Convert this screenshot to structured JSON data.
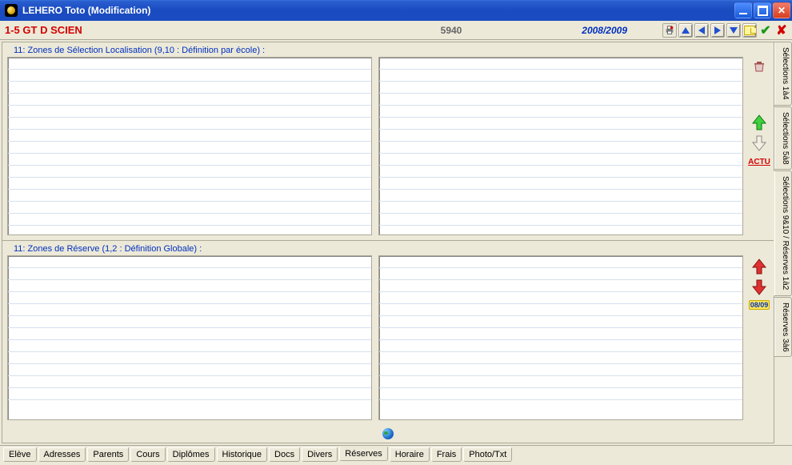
{
  "window": {
    "title": "LEHERO Toto (Modification)"
  },
  "header": {
    "class_label": "1-5 GT D SCIEN",
    "center_number": "5940",
    "year": "2008/2009"
  },
  "groups": {
    "g1_title": "11: Zones de Sélection Localisation (9,10 : Définition par école) :",
    "g2_title": "11: Zones de Réserve (1,2 : Définition Globale) :"
  },
  "side": {
    "actu_label": "ACTU",
    "year_badge": "08/09"
  },
  "right_tabs": [
    "Sélections 1à4",
    "Sélections 5à8",
    "Sélections 9&10 / Réserves 1à2",
    "Réserves 3à6"
  ],
  "right_tab_active_index": 2,
  "bottom_tabs": [
    "Elève",
    "Adresses",
    "Parents",
    "Cours",
    "Diplômes",
    "Historique",
    "Docs",
    "Divers",
    "Réserves",
    "Horaire",
    "Frais",
    "Photo/Txt"
  ],
  "bottom_tab_active_index": 8
}
